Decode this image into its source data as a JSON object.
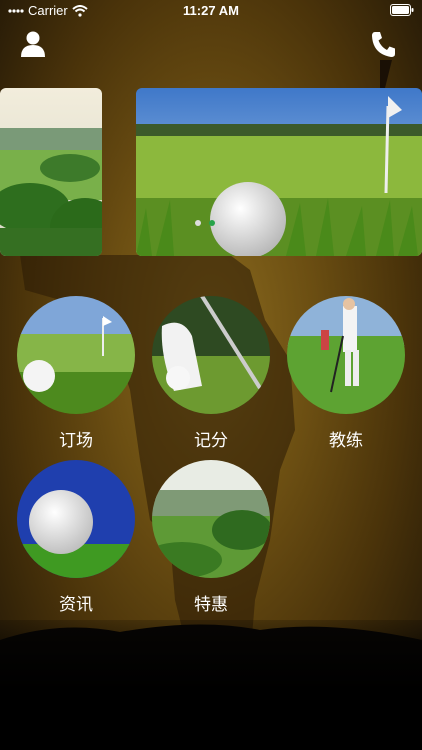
{
  "status": {
    "carrier": "Carrier",
    "time": "11:27 AM"
  },
  "header": {
    "user_icon": "user-icon",
    "phone_icon": "phone-icon"
  },
  "carousel": {
    "slides": 2,
    "active_index": 1
  },
  "menu": [
    {
      "label": "订场"
    },
    {
      "label": "记分"
    },
    {
      "label": "教练"
    },
    {
      "label": "资讯"
    },
    {
      "label": "特惠"
    }
  ],
  "colors": {
    "accent": "#27a34a",
    "background": "#6b4e12"
  }
}
